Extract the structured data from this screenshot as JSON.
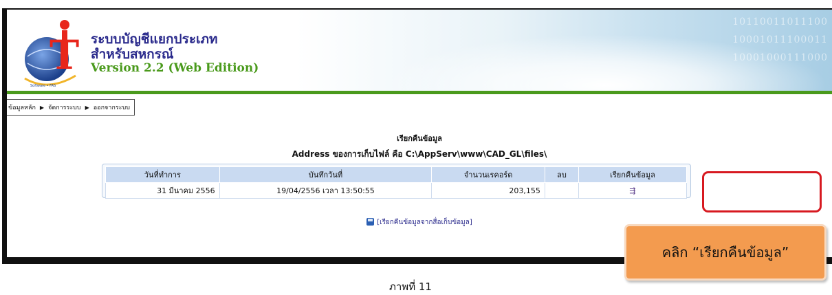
{
  "banner": {
    "title_line1": "ระบบบัญชีแยกประเภท",
    "title_line2": "สำหรับสหกรณ์",
    "version": "Version 2.2 (Web Edition)",
    "binary_lines": [
      "10110011011100",
      "10001011100011",
      "10001000111000"
    ],
    "logo_text": "iT",
    "logo_ring_text": "Full Pack Accounting Software • FAS"
  },
  "menu": {
    "items": [
      "ข้อมูลหลัก",
      "จัดการระบบ",
      "ออกจากระบบ"
    ]
  },
  "main": {
    "heading": "เรียกคืนข้อมูล",
    "address_line": "Address ของการเก็บไฟล์ คือ C:\\AppServ\\www\\CAD_GL\\files\\",
    "table": {
      "headers": [
        "วันที่ทำการ",
        "บันทึกวันที่",
        "จำนวนเรคอร์ด",
        "ลบ",
        "เรียกคืนข้อมูล"
      ],
      "rows": [
        {
          "date": "31 มีนาคม 2556",
          "saved": "19/04/2556  เวลา 13:50:55",
          "records": "203,155",
          "delete": "",
          "restore_icon": "restore-icon"
        }
      ]
    },
    "restore_media_link": "[เรียกคืนข้อมูลจากสื่อเก็บข้อมูล]"
  },
  "annotation": {
    "callout": "คลิก “เรียกคืนข้อมูล”",
    "caption": "ภาพที่ 11",
    "highlight_color": "#d71920",
    "callout_color": "#f39b4f"
  }
}
